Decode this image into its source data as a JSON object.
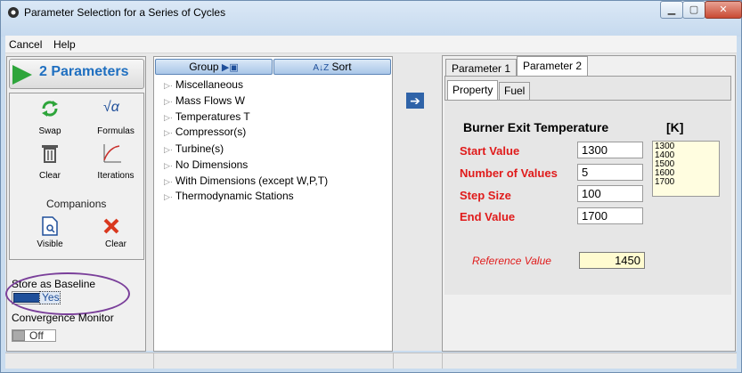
{
  "window": {
    "title": "Parameter Selection for a Series of Cycles"
  },
  "menu": {
    "items": [
      "Cancel",
      "Help"
    ]
  },
  "left": {
    "params_button": "2 Parameters",
    "swap": "Swap",
    "formulas": "Formulas",
    "clear": "Clear",
    "iterations": "Iterations",
    "companions": "Companions",
    "visible": "Visible",
    "clear2": "Clear",
    "store_label": "Store as Baseline",
    "store_value": "Yes",
    "convergence_label": "Convergence Monitor",
    "convergence_value": "Off"
  },
  "tree": {
    "group_button": "Group",
    "sort_button": "Sort",
    "items": [
      "Miscellaneous",
      "Mass Flows W",
      "Temperatures T",
      "Compressor(s)",
      "Turbine(s)",
      "No Dimensions",
      "With Dimensions (except W,P,T)",
      "Thermodynamic Stations"
    ]
  },
  "tabs": {
    "p1": "Parameter 1",
    "p2": "Parameter 2",
    "property": "Property",
    "fuel": "Fuel"
  },
  "param": {
    "title": "Burner Exit Temperature",
    "unit": "[K]",
    "start_label": "Start Value",
    "start_value": "1300",
    "num_label": "Number of Values",
    "num_value": "5",
    "step_label": "Step Size",
    "step_value": "100",
    "end_label": "End Value",
    "end_value": "1700",
    "values": [
      "1300",
      "1400",
      "1500",
      "1600",
      "1700"
    ],
    "ref_label": "Reference Value",
    "ref_value": "1450"
  },
  "colors": {
    "accent_red": "#e01b1b",
    "toggle_blue": "#1f4f9a",
    "highlight_circle": "#7a3f9a"
  }
}
